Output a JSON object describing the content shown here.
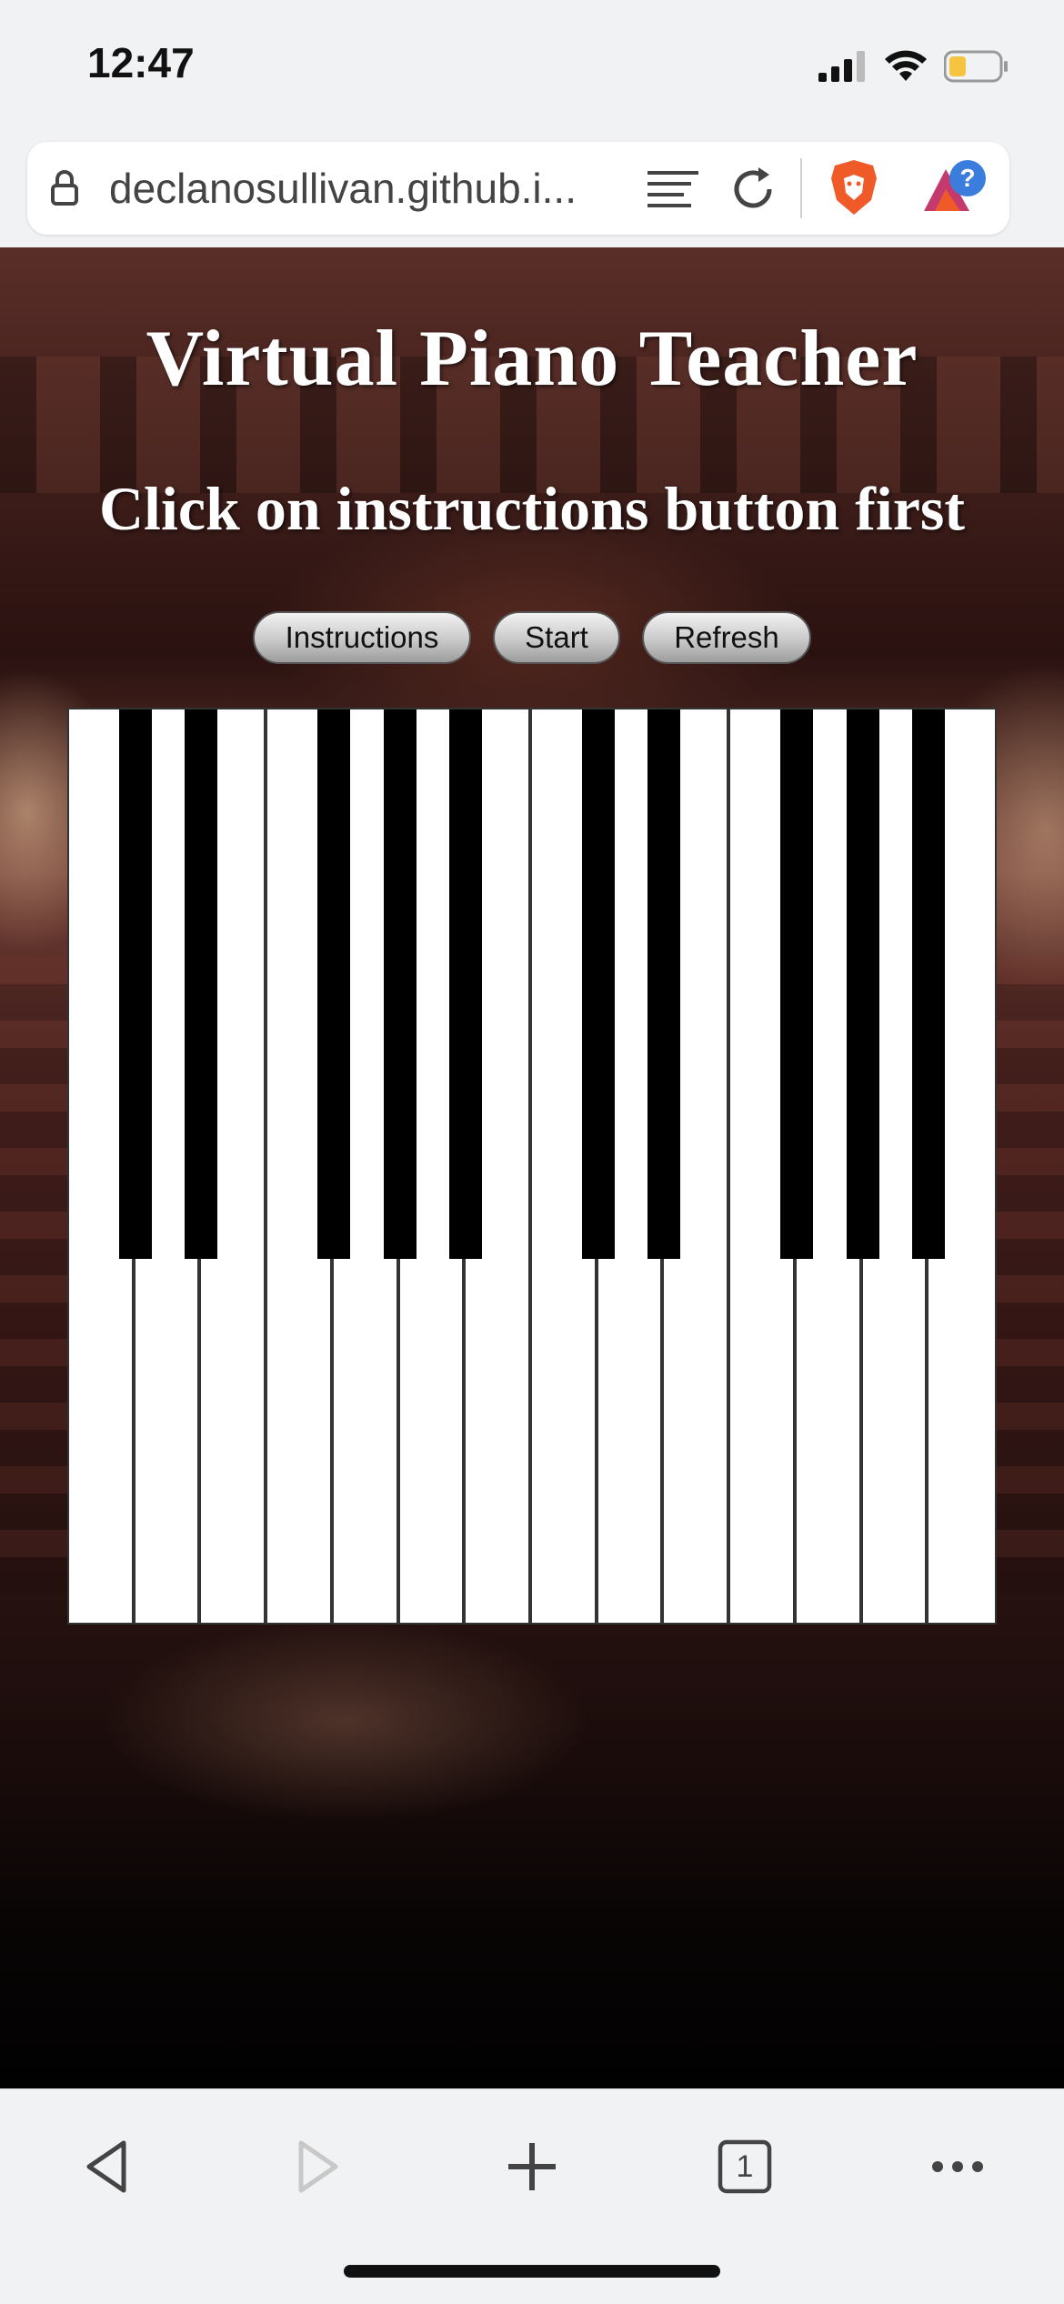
{
  "status_bar": {
    "time": "12:47",
    "icons": [
      "cellular-signal-icon",
      "wifi-icon",
      "battery-icon"
    ],
    "battery_color": "#f5c542"
  },
  "browser": {
    "url": "declanosullivan.github.i...",
    "icons": [
      "lock-icon",
      "reader-mode-icon",
      "reload-icon",
      "brave-shields-icon",
      "brave-rewards-icon"
    ],
    "accent_color": "#f05a28"
  },
  "page": {
    "title": "Virtual Piano Teacher",
    "subtitle": "Click on instructions button first",
    "buttons": {
      "instructions": "Instructions",
      "start": "Start",
      "refresh": "Refresh"
    },
    "piano": {
      "white_keys": 14,
      "black_keys": 10
    }
  },
  "toolbar": {
    "icons": [
      "back-icon",
      "forward-icon",
      "new-tab-icon",
      "tabs-icon",
      "more-icon"
    ],
    "tab_count": "1"
  }
}
